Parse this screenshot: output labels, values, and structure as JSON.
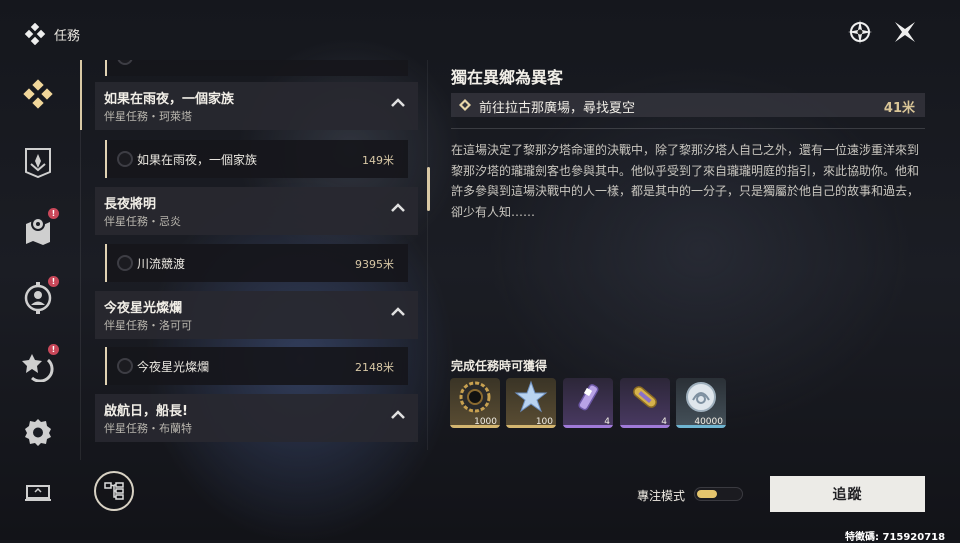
{
  "header": {
    "title": "任務",
    "icon": "quest-diamond-icon"
  },
  "top_right": [
    {
      "name": "hoyolab-compass-icon"
    },
    {
      "name": "close-icon"
    }
  ],
  "sidebar": {
    "items": [
      {
        "name": "companion-quest-icon",
        "active": true,
        "badge": ""
      },
      {
        "name": "trailblaze-quest-icon",
        "active": false,
        "badge": ""
      },
      {
        "name": "map-quest-icon",
        "active": false,
        "badge": "!"
      },
      {
        "name": "adventure-quest-icon",
        "active": false,
        "badge": "!"
      },
      {
        "name": "daily-quest-icon",
        "active": false,
        "badge": "!"
      },
      {
        "name": "settings-icon",
        "active": false,
        "badge": ""
      },
      {
        "name": "screen-icon",
        "active": false,
        "badge": ""
      }
    ]
  },
  "quests": [
    {
      "title": "如果在雨夜，一個家族",
      "subtitle": "伴星任務・珂萊塔",
      "sub_item": {
        "label": "如果在雨夜，一個家族",
        "distance": "149米"
      }
    },
    {
      "title": "長夜將明",
      "subtitle": "伴星任務・忌炎",
      "sub_item": {
        "label": "川流競渡",
        "distance": "9395米"
      }
    },
    {
      "title": "今夜星光燦爛",
      "subtitle": "伴星任務・洛可可",
      "sub_item": {
        "label": "今夜星光燦爛",
        "distance": "2148米"
      }
    },
    {
      "title": "啟航日，船長!",
      "subtitle": "伴星任務・布蘭特"
    }
  ],
  "detail": {
    "title": "獨在異鄉為異客",
    "objective": {
      "label": "前往拉古那廣場，尋找夏空",
      "distance": "41米"
    },
    "description": "在這場決定了黎那汐塔命運的決戰中，除了黎那汐塔人自己之外，還有一位遠涉重洋來到黎那汐塔的瓏瓏劍客也參與其中。他似乎受到了來自瓏瓏明庭的指引，來此協助你。他和許多參與到這場決戰中的人一樣，都是其中的一分子，只是獨屬於他自己的故事和過去，卻少有人知……",
    "rewards_label": "完成任務時可獲得",
    "rewards": [
      {
        "icon": "shell-credit-gear-icon",
        "count": "1000",
        "rarity_color": "#d4b670"
      },
      {
        "icon": "union-exp-crystal-icon",
        "count": "100",
        "rarity_color": "#d4b670"
      },
      {
        "icon": "purple-tube-item-icon",
        "count": "4",
        "rarity_color": "#a07ad8"
      },
      {
        "icon": "golden-capsule-item-icon",
        "count": "4",
        "rarity_color": "#a07ad8"
      },
      {
        "icon": "silver-shell-coin-icon",
        "count": "40000",
        "rarity_color": "#6fb5d2"
      }
    ]
  },
  "footer": {
    "focus_mode_label": "專注模式",
    "focus_mode_on": true,
    "track_label": "追蹤",
    "uid": "特徵碼: 715920718"
  }
}
